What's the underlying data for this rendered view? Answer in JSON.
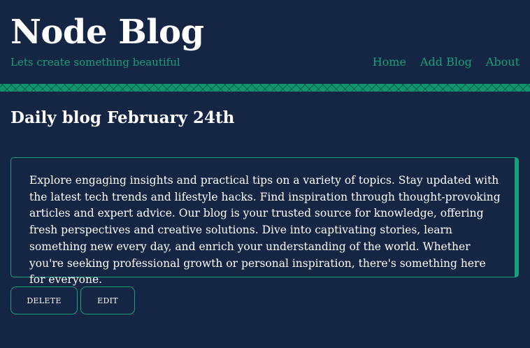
{
  "header": {
    "site_title": "Node Blog",
    "tagline": "Lets create something beautiful",
    "nav": [
      {
        "label": "Home"
      },
      {
        "label": "Add Blog"
      },
      {
        "label": "About"
      }
    ]
  },
  "post": {
    "title": "Daily blog February 24th",
    "body": "Explore engaging insights and practical tips on a variety of topics. Stay updated with the latest tech trends and lifestyle hacks. Find inspiration through thought-provoking articles and expert advice. Our blog is your trusted source for knowledge, offering fresh perspectives and creative solutions. Dive into captivating stories, learn something new every day, and enrich your understanding of the world. Whether you're seeking professional growth or personal inspiration, there's something here for everyone."
  },
  "actions": {
    "delete_label": "DELETE",
    "edit_label": "EDIT"
  },
  "colors": {
    "background": "#152544",
    "accent": "#17a07a",
    "text": "#ffffff"
  }
}
